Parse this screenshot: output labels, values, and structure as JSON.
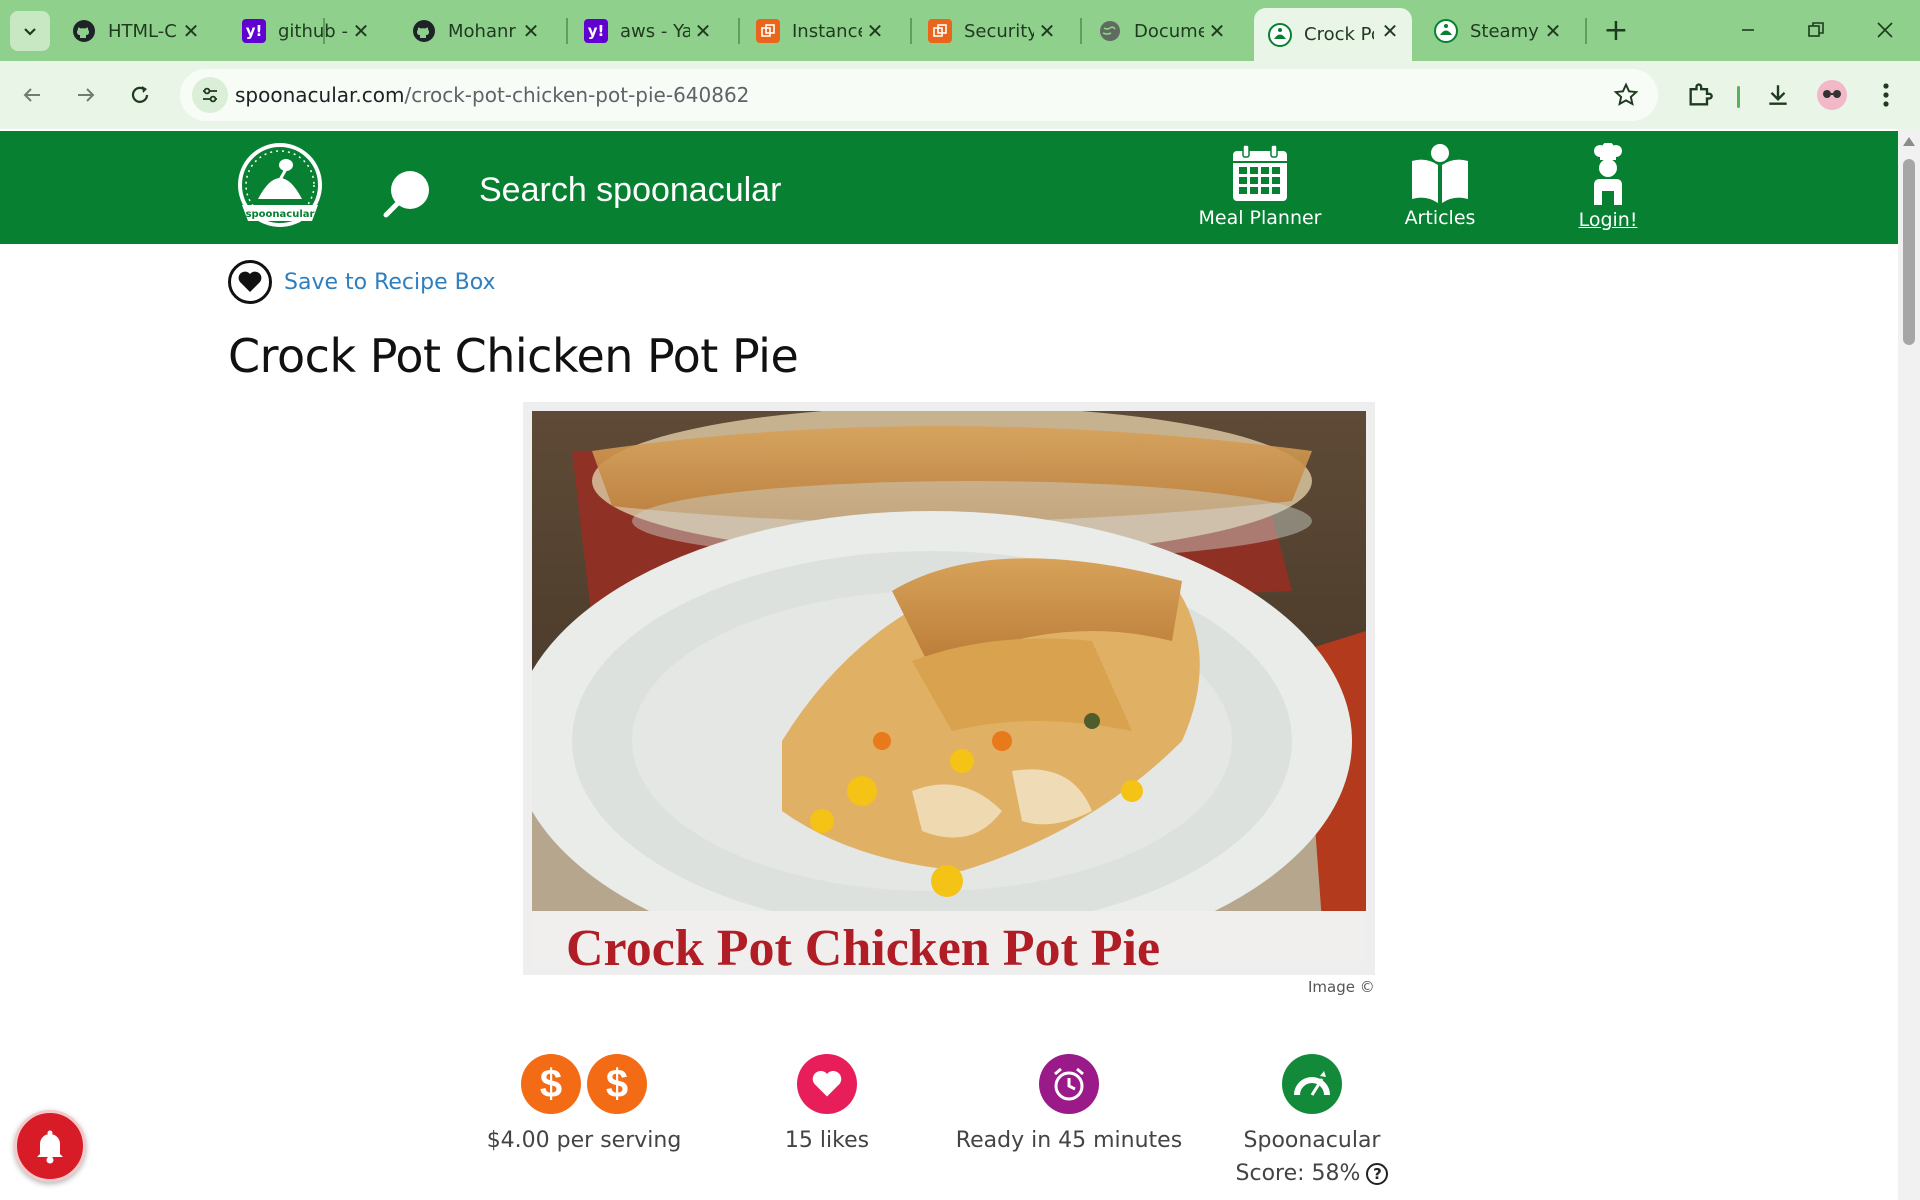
{
  "browser": {
    "tabs": [
      {
        "label": "HTML-C",
        "icon": "github-icon"
      },
      {
        "label": "github -",
        "icon": "yahoo-icon"
      },
      {
        "label": "Mohanr",
        "icon": "github-icon"
      },
      {
        "label": "aws - Ya",
        "icon": "yahoo-icon"
      },
      {
        "label": "Instance",
        "icon": "aws-icon"
      },
      {
        "label": "Security",
        "icon": "aws-icon"
      },
      {
        "label": "Docume",
        "icon": "globe-icon"
      },
      {
        "label": "Crock Po",
        "icon": "spoonacular-icon",
        "active": true
      },
      {
        "label": "Steamy",
        "icon": "spoonacular-icon"
      }
    ],
    "url_host": "spoonacular.com",
    "url_path": "/crock-pot-chicken-pot-pie-640862",
    "accent": "#8fd08c"
  },
  "site": {
    "brand_color": "#078032",
    "search_placeholder": "Search spoonacular",
    "nav": {
      "meal_planner": "Meal Planner",
      "articles": "Articles",
      "login": "Login!"
    }
  },
  "recipe": {
    "save_label": "Save to Recipe Box",
    "title": "Crock Pot Chicken Pot Pie",
    "image_caption": "Crock Pot Chicken Pot Pie",
    "image_credit": "Image ©",
    "price": "$4.00 per serving",
    "likes": "15 likes",
    "ready": "Ready in 45 minutes",
    "score_label": "Spoonacular",
    "score_value": "Score: 58%"
  }
}
